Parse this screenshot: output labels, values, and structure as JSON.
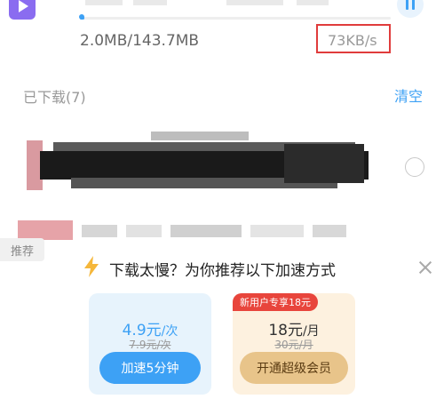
{
  "downloading": {
    "size_progress": "2.0MB/143.7MB",
    "speed": "73KB/s",
    "progress_fraction": 0.014
  },
  "downloaded_section": {
    "title": "已下载(7)",
    "clear_label": "清空"
  },
  "recommend_tag": "推荐",
  "promo": {
    "title": "下载太慢？为你推荐以下加速方式",
    "options": [
      {
        "price": "4.9元",
        "unit": "/次",
        "original_price": "7.9元/次",
        "button_label": "加速5分钟",
        "accent": "#3da1f5"
      },
      {
        "badge": "新用户专享18元",
        "price": "18元",
        "unit": "/月",
        "original_price": "30元/月",
        "button_label": "开通超级会员",
        "accent": "#e8c48a"
      }
    ]
  },
  "colors": {
    "accent_blue": "#3da1f5",
    "highlight_red": "#e03c3c",
    "thumb_purple": "#8a6cf0"
  },
  "icons": {
    "thumb": "play-icon",
    "pause": "pause-icon",
    "promo": "lightning-icon",
    "close": "close-icon"
  }
}
